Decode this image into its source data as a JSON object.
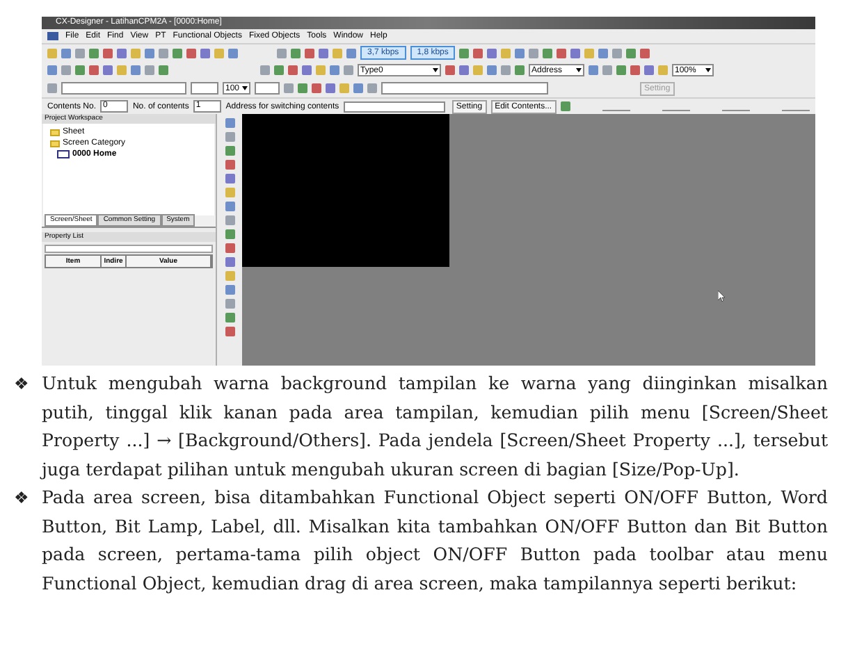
{
  "window": {
    "title": "CX-Designer - LatihanCPM2A - [0000:Home]"
  },
  "menu": [
    "File",
    "Edit",
    "Find",
    "View",
    "PT",
    "Functional Objects",
    "Fixed Objects",
    "Tools",
    "Window",
    "Help"
  ],
  "toolbar_1": {
    "fields": [
      "3,7 kbps",
      "1,8 kbps"
    ]
  },
  "toolbar_2": {
    "type_select": "Type0",
    "address_select": "Address",
    "zoom_select": "100%"
  },
  "toolbar_3": {
    "size_spin": "100",
    "setting_button": "Setting"
  },
  "contents_bar": {
    "contents_no_label": "Contents No.",
    "contents_no": "0",
    "count_label": "No. of contents",
    "count": "1",
    "address_label": "Address for switching contents",
    "setting_button": "Setting",
    "edit_button": "Edit Contents..."
  },
  "workspace": {
    "title": "Project Workspace",
    "tree": [
      {
        "label": "Sheet",
        "kind": "folder"
      },
      {
        "label": "Screen Category",
        "kind": "folder",
        "children": [
          {
            "label": "0000 Home",
            "kind": "screen"
          }
        ]
      }
    ],
    "tabs": [
      {
        "label": "Screen/Sheet",
        "selected": true
      },
      {
        "label": "Common Setting",
        "selected": false
      },
      {
        "label": "System",
        "selected": false
      }
    ]
  },
  "property_list": {
    "title": "Property List",
    "columns": [
      "Item",
      "Indire",
      "Value"
    ]
  },
  "paragraphs": [
    {
      "marker": "❖",
      "text": "Untuk mengubah warna background tampilan ke warna yang diinginkan misalkan putih, tinggal klik kanan pada area tampilan, kemudian pilih menu [Screen/Sheet Property ...] → [Background/Others]. Pada jendela [Screen/Sheet Property ...], tersebut juga terdapat pilihan untuk mengubah ukuran screen di bagian  [Size/Pop-Up]."
    },
    {
      "marker": "❖",
      "text": "Pada area screen, bisa ditambahkan Functional Object seperti ON/OFF Button, Word Button, Bit Lamp, Label, dll. Misalkan kita tambahkan ON/OFF Button dan Bit Button pada screen, pertama-tama pilih object ON/OFF Button pada toolbar atau menu Functional Object, kemudian drag di area screen, maka tampilannya seperti berikut:"
    }
  ]
}
